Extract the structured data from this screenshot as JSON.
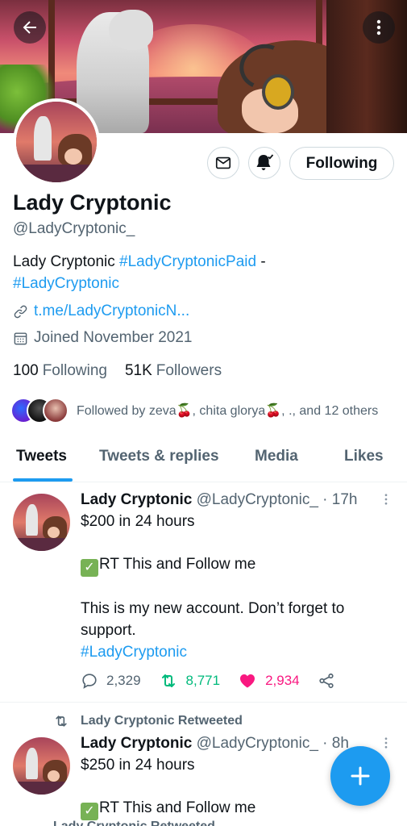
{
  "profile": {
    "name": "Lady Cryptonic",
    "handle": "@LadyCryptonic_",
    "bio_text": "Lady Cryptonic ",
    "bio_tag1": "#LadyCryptonicPaid",
    "bio_sep": " -",
    "bio_tag2": "#LadyCryptonic",
    "url": "t.me/LadyCryptonicN...",
    "joined": "Joined November 2021",
    "following_count": "100",
    "following_label": "Following",
    "followers_count": "51K",
    "followers_label": "Followers",
    "followed_by": "Followed by zeva🍒, chita glorya🍒, ., and 12 others",
    "following_button": "Following"
  },
  "tabs": [
    {
      "label": "Tweets",
      "active": true
    },
    {
      "label": "Tweets & replies",
      "active": false
    },
    {
      "label": "Media",
      "active": false
    },
    {
      "label": "Likes",
      "active": false
    }
  ],
  "tweets": [
    {
      "name": "Lady Cryptonic",
      "handle_time": "@LadyCryptonic_ · 17h",
      "line1": "$200 in 24 hours",
      "line2": "RT This and Follow me",
      "line3": "This is my new account. Don’t forget to support.",
      "hashtag": "#LadyCryptonic",
      "replies": "2,329",
      "retweets": "8,771",
      "likes": "2,934"
    },
    {
      "retweeted_by": "Lady Cryptonic Retweeted",
      "name": "Lady Cryptonic",
      "handle_time": "@LadyCryptonic_ · 8h",
      "line1": "$250 in 24 hours",
      "line2": "RT This and Follow me"
    }
  ],
  "peek_text": "Lady Cryptonic Retweeted",
  "colors": {
    "accent": "#1d9bf0",
    "retweet": "#00ba7c",
    "like": "#f91880",
    "muted": "#536471"
  }
}
